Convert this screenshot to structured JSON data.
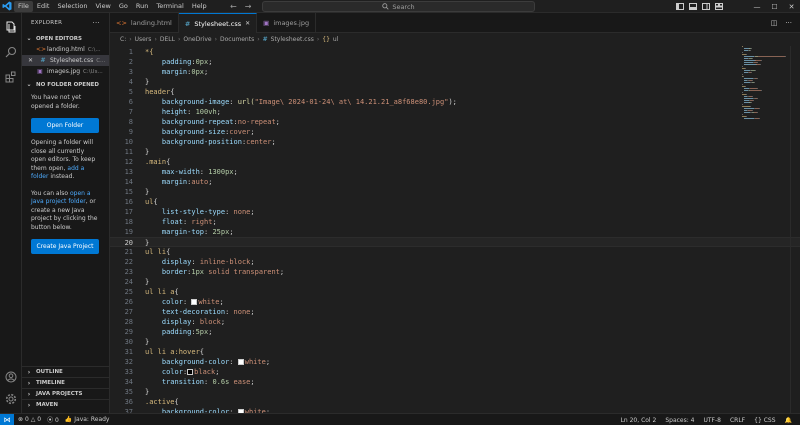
{
  "menu": [
    "File",
    "Edit",
    "Selection",
    "View",
    "Go",
    "Run",
    "Terminal",
    "Help"
  ],
  "search": {
    "label": "Search"
  },
  "sidebar": {
    "title": "EXPLORER",
    "open_editors_label": "OPEN EDITORS",
    "open_editors": [
      {
        "name": "landing.html",
        "path": "C:\\...",
        "icon": "html-file-icon",
        "active": false
      },
      {
        "name": "Stylesheet.css",
        "path": "C...",
        "icon": "css-file-icon",
        "active": true
      },
      {
        "name": "images.jpg",
        "path": "C:\\Us...",
        "icon": "image-file-icon",
        "active": false
      }
    ],
    "no_folder_label": "NO FOLDER OPENED",
    "welcome_text": "You have not yet opened a folder.",
    "open_folder_button": "Open Folder",
    "info_text_1": "Opening a folder will close all currently open editors. To keep them open,",
    "add_folder_link": "add a folder",
    "info_text_1_end": "instead.",
    "info_text_2_start": "You can also",
    "java_link": "open a Java project folder",
    "info_text_2_end": ", or create a new Java project by clicking the button below.",
    "create_java_button": "Create Java Project",
    "bottom_sections": [
      "OUTLINE",
      "TIMELINE",
      "JAVA PROJECTS",
      "MAVEN"
    ]
  },
  "tabs": [
    {
      "label": "landing.html",
      "icon": "html-file-icon",
      "active": false
    },
    {
      "label": "Stylesheet.css",
      "icon": "css-file-icon",
      "active": true
    },
    {
      "label": "images.jpg",
      "icon": "image-file-icon",
      "active": false
    }
  ],
  "breadcrumb": [
    "C:",
    "Users",
    "DELL",
    "OneDrive",
    "Documents",
    "Stylesheet.css",
    "ul"
  ],
  "editor": {
    "current_line": 20,
    "lines": [
      [
        [
          "*{",
          "t-sel"
        ]
      ],
      [
        [
          "    ",
          ""
        ],
        [
          "padding",
          "t-prop"
        ],
        [
          ":",
          "t-pun"
        ],
        [
          "0px",
          "t-num"
        ],
        [
          ";",
          "t-pun"
        ]
      ],
      [
        [
          "    ",
          ""
        ],
        [
          "margin",
          "t-prop"
        ],
        [
          ":",
          "t-pun"
        ],
        [
          "0px",
          "t-num"
        ],
        [
          ";",
          "t-pun"
        ]
      ],
      [
        [
          "}",
          "t-pun"
        ]
      ],
      [
        [
          "header",
          "t-sel"
        ],
        [
          "{",
          "t-pun"
        ]
      ],
      [
        [
          "    ",
          ""
        ],
        [
          "background-image",
          "t-prop"
        ],
        [
          ": ",
          "t-pun"
        ],
        [
          "url(",
          "t-fn"
        ],
        [
          "\"Image\\ 2024-01-24\\ at\\ 14.21.21_a8f68e80.jpg\"",
          "t-val"
        ],
        [
          ");",
          "t-pun"
        ]
      ],
      [
        [
          "    ",
          ""
        ],
        [
          "height",
          "t-prop"
        ],
        [
          ": ",
          "t-pun"
        ],
        [
          "100vh",
          "t-num"
        ],
        [
          ";",
          "t-pun"
        ]
      ],
      [
        [
          "    ",
          ""
        ],
        [
          "background-repeat",
          "t-prop"
        ],
        [
          ":",
          "t-pun"
        ],
        [
          "no-repeat",
          "t-val"
        ],
        [
          ";",
          "t-pun"
        ]
      ],
      [
        [
          "    ",
          ""
        ],
        [
          "background-size",
          "t-prop"
        ],
        [
          ":",
          "t-pun"
        ],
        [
          "cover",
          "t-val"
        ],
        [
          ";",
          "t-pun"
        ]
      ],
      [
        [
          "    ",
          ""
        ],
        [
          "background-position",
          "t-prop"
        ],
        [
          ":",
          "t-pun"
        ],
        [
          "center",
          "t-val"
        ],
        [
          ";",
          "t-pun"
        ]
      ],
      [
        [
          "}",
          "t-pun"
        ]
      ],
      [
        [
          ".main",
          "t-sel"
        ],
        [
          "{",
          "t-pun"
        ]
      ],
      [
        [
          "    ",
          ""
        ],
        [
          "max-width",
          "t-prop"
        ],
        [
          ": ",
          "t-pun"
        ],
        [
          "1300px",
          "t-num"
        ],
        [
          ";",
          "t-pun"
        ]
      ],
      [
        [
          "    ",
          ""
        ],
        [
          "margin",
          "t-prop"
        ],
        [
          ":",
          "t-pun"
        ],
        [
          "auto",
          "t-val"
        ],
        [
          ";",
          "t-pun"
        ]
      ],
      [
        [
          "}",
          "t-pun"
        ]
      ],
      [
        [
          "ul",
          "t-sel"
        ],
        [
          "{",
          "t-pun"
        ]
      ],
      [
        [
          "    ",
          ""
        ],
        [
          "list-style-type",
          "t-prop"
        ],
        [
          ": ",
          "t-pun"
        ],
        [
          "none",
          "t-val"
        ],
        [
          ";",
          "t-pun"
        ]
      ],
      [
        [
          "    ",
          ""
        ],
        [
          "float",
          "t-prop"
        ],
        [
          ": ",
          "t-pun"
        ],
        [
          "right",
          "t-val"
        ],
        [
          ";",
          "t-pun"
        ]
      ],
      [
        [
          "    ",
          ""
        ],
        [
          "margin-top",
          "t-prop"
        ],
        [
          ": ",
          "t-pun"
        ],
        [
          "25px",
          "t-num"
        ],
        [
          ";",
          "t-pun"
        ]
      ],
      [
        [
          "}",
          "t-pun"
        ]
      ],
      [
        [
          "ul li",
          "t-sel"
        ],
        [
          "{",
          "t-pun"
        ]
      ],
      [
        [
          "    ",
          ""
        ],
        [
          "display",
          "t-prop"
        ],
        [
          ": ",
          "t-pun"
        ],
        [
          "inline-block",
          "t-val"
        ],
        [
          ";",
          "t-pun"
        ]
      ],
      [
        [
          "    ",
          ""
        ],
        [
          "border",
          "t-prop"
        ],
        [
          ":",
          "t-pun"
        ],
        [
          "1px",
          "t-num"
        ],
        [
          " solid transparent",
          "t-val"
        ],
        [
          ";",
          "t-pun"
        ]
      ],
      [
        [
          "}",
          "t-pun"
        ]
      ],
      [
        [
          "ul li a",
          "t-sel"
        ],
        [
          "{",
          "t-pun"
        ]
      ],
      [
        [
          "    ",
          ""
        ],
        [
          "color",
          "t-prop"
        ],
        [
          ": ",
          "t-pun"
        ],
        [
          "#ffffff|white",
          "swatch"
        ],
        [
          ";",
          "t-pun"
        ]
      ],
      [
        [
          "    ",
          ""
        ],
        [
          "text-decoration",
          "t-prop"
        ],
        [
          ": ",
          "t-pun"
        ],
        [
          "none",
          "t-val"
        ],
        [
          ";",
          "t-pun"
        ]
      ],
      [
        [
          "    ",
          ""
        ],
        [
          "display",
          "t-prop"
        ],
        [
          ": ",
          "t-pun"
        ],
        [
          "block",
          "t-val"
        ],
        [
          ";",
          "t-pun"
        ]
      ],
      [
        [
          "    ",
          ""
        ],
        [
          "padding",
          "t-prop"
        ],
        [
          ":",
          "t-pun"
        ],
        [
          "5px",
          "t-num"
        ],
        [
          ";",
          "t-pun"
        ]
      ],
      [
        [
          "}",
          "t-pun"
        ]
      ],
      [
        [
          "ul li a:hover",
          "t-sel"
        ],
        [
          "{",
          "t-pun"
        ]
      ],
      [
        [
          "    ",
          ""
        ],
        [
          "background-color",
          "t-prop"
        ],
        [
          ": ",
          "t-pun"
        ],
        [
          "#ffffff|white",
          "swatch"
        ],
        [
          ";",
          "t-pun"
        ]
      ],
      [
        [
          "    ",
          ""
        ],
        [
          "color",
          "t-prop"
        ],
        [
          ":",
          "t-pun"
        ],
        [
          "#000000|black",
          "swatch"
        ],
        [
          ";",
          "t-pun"
        ]
      ],
      [
        [
          "    ",
          ""
        ],
        [
          "transition",
          "t-prop"
        ],
        [
          ": ",
          "t-pun"
        ],
        [
          "0.6s",
          "t-num"
        ],
        [
          " ease",
          "t-val"
        ],
        [
          ";",
          "t-pun"
        ]
      ],
      [
        [
          "}",
          "t-pun"
        ]
      ],
      [
        [
          ".active",
          "t-sel"
        ],
        [
          "{",
          "t-pun"
        ]
      ],
      [
        [
          "    ",
          ""
        ],
        [
          "background-color",
          "t-prop"
        ],
        [
          ": ",
          "t-pun"
        ],
        [
          "#ffffff|white",
          "swatch"
        ],
        [
          ";",
          "t-pun"
        ]
      ]
    ]
  },
  "status": {
    "errors": "0",
    "warnings": "0",
    "ports": "0",
    "java": "Java: Ready",
    "position": "Ln 20, Col 2",
    "spaces": "Spaces: 4",
    "encoding": "UTF-8",
    "eol": "CRLF",
    "language": "CSS"
  },
  "colors": {
    "accent": "#0078d4",
    "link": "#4daafc"
  }
}
